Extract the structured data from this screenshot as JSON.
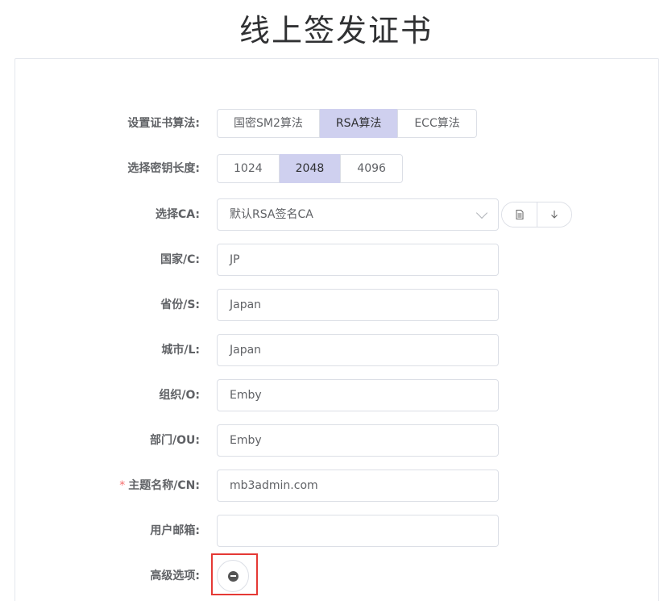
{
  "page": {
    "title": "线上签发证书"
  },
  "form": {
    "algorithm": {
      "label": "设置证书算法:",
      "options": [
        "国密SM2算法",
        "RSA算法",
        "ECC算法"
      ],
      "selected": "RSA算法"
    },
    "key_length": {
      "label": "选择密钥长度:",
      "options": [
        "1024",
        "2048",
        "4096"
      ],
      "selected": "2048"
    },
    "ca": {
      "label": "选择CA:",
      "value": "默认RSA签名CA",
      "actions": [
        "document-icon",
        "download-icon"
      ]
    },
    "country": {
      "label": "国家/C:",
      "value": "JP"
    },
    "province": {
      "label": "省份/S:",
      "value": "Japan"
    },
    "city": {
      "label": "城市/L:",
      "value": "Japan"
    },
    "organization": {
      "label": "组织/O:",
      "value": "Emby"
    },
    "department": {
      "label": "部门/OU:",
      "value": "Emby"
    },
    "common_name": {
      "required_mark": "*",
      "label": "主题名称/CN:",
      "value": "mb3admin.com"
    },
    "email": {
      "label": "用户邮箱:",
      "value": ""
    },
    "advanced": {
      "label": "高级选项:",
      "icon": "minus-circle-icon"
    }
  },
  "colors": {
    "selected_bg": "#cfd0ef",
    "border": "#dcdfe6",
    "required": "#f56c6c",
    "highlight_box": "#e53935"
  }
}
